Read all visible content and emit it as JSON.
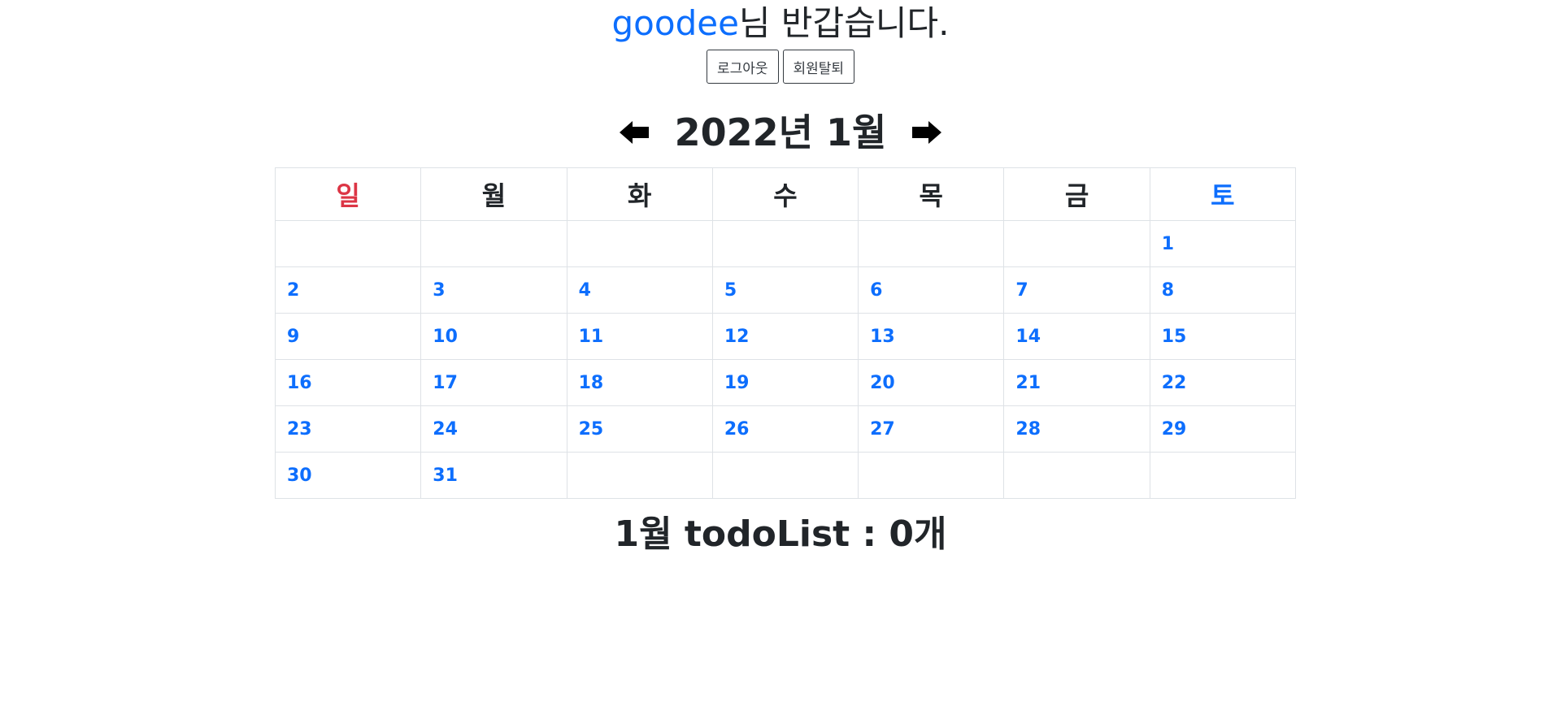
{
  "header": {
    "username": "goodee",
    "greeting_suffix": "님 반갑습니다.",
    "logout_label": "로그아웃",
    "withdraw_label": "회원탈퇴"
  },
  "calendar": {
    "title": "2022년 1월",
    "prev_icon": "arrow-left-icon",
    "next_icon": "arrow-right-icon",
    "weekdays": [
      "일",
      "월",
      "화",
      "수",
      "목",
      "금",
      "토"
    ],
    "weeks": [
      [
        "",
        "",
        "",
        "",
        "",
        "",
        "1"
      ],
      [
        "2",
        "3",
        "4",
        "5",
        "6",
        "7",
        "8"
      ],
      [
        "9",
        "10",
        "11",
        "12",
        "13",
        "14",
        "15"
      ],
      [
        "16",
        "17",
        "18",
        "19",
        "20",
        "21",
        "22"
      ],
      [
        "23",
        "24",
        "25",
        "26",
        "27",
        "28",
        "29"
      ],
      [
        "30",
        "31",
        "",
        "",
        "",
        "",
        ""
      ]
    ],
    "colors": {
      "sunday": "#dc3545",
      "saturday": "#0d6efd",
      "date_link": "#0d6efd"
    }
  },
  "todo": {
    "summary": "1월 todoList : 0개"
  }
}
